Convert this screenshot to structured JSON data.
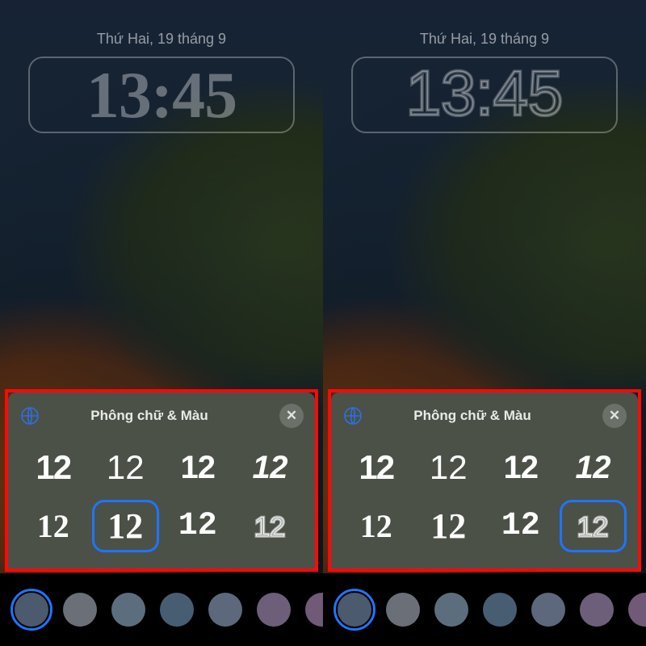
{
  "left": {
    "date": "Thứ Hai, 19 tháng 9",
    "time": "13:45",
    "panel_title": "Phông chữ & Màu",
    "selected_font_index": 5,
    "selected_color_index": 0
  },
  "right": {
    "date": "Thứ Hai, 19 tháng 9",
    "time": "13:45",
    "panel_title": "Phông chữ & Màu",
    "selected_font_index": 7,
    "selected_color_index": 0
  },
  "font_options": [
    {
      "label": "12",
      "style": "sans-heavy"
    },
    {
      "label": "12",
      "style": "sans-light"
    },
    {
      "label": "12",
      "style": "rounded"
    },
    {
      "label": "12",
      "style": "stencil"
    },
    {
      "label": "12",
      "style": "serif-med"
    },
    {
      "label": "12",
      "style": "serif-heavy"
    },
    {
      "label": "12",
      "style": "slab"
    },
    {
      "label": "12",
      "style": "outline"
    }
  ],
  "color_swatches": [
    "#4b5a6c",
    "#6b6f78",
    "#5c6e7e",
    "#475d72",
    "#5d687c",
    "#6d5f7a",
    "#715a78"
  ]
}
